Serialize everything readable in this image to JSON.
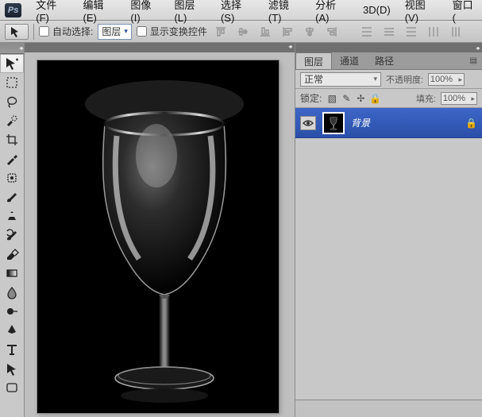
{
  "menu": {
    "items": [
      "文件(F)",
      "编辑(E)",
      "图像(I)",
      "图层(L)",
      "选择(S)",
      "滤镜(T)",
      "分析(A)",
      "3D(D)",
      "视图(V)",
      "窗口("
    ]
  },
  "options": {
    "auto_select_label": "自动选择:",
    "auto_select_value": "图层",
    "show_transform_label": "显示变换控件"
  },
  "tools": {
    "names": [
      "move-tool",
      "marquee-tool",
      "lasso-tool",
      "quick-select-tool",
      "crop-tool",
      "eyedropper-tool",
      "healing-brush-tool",
      "brush-tool",
      "clone-stamp-tool",
      "history-brush-tool",
      "eraser-tool",
      "gradient-tool",
      "blur-tool",
      "dodge-tool",
      "pen-tool",
      "type-tool",
      "path-select-tool",
      "shape-tool"
    ]
  },
  "panel": {
    "tabs": [
      "图层",
      "通道",
      "路径"
    ],
    "blend_mode": "正常",
    "opacity_label": "不透明度:",
    "opacity_value": "100%",
    "lock_label": "锁定:",
    "fill_label": "填充:",
    "fill_value": "100%",
    "layers": [
      {
        "name": "背景",
        "locked": true
      }
    ]
  }
}
